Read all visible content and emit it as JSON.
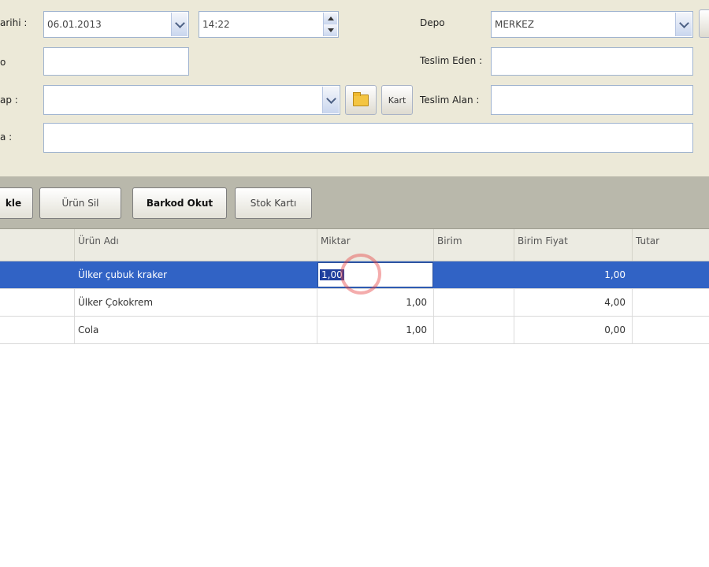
{
  "form": {
    "date_label": "arihi :",
    "date_value": "06.01.2013",
    "time_value": "14:22",
    "depo_label": "Depo",
    "depo_value": "MERKEZ",
    "row2_label": "o",
    "teslim_eden_label": "Teslim Eden :",
    "row3_label": "ap :",
    "kart_button": "Kart",
    "teslim_alan_label": "Teslim Alan :",
    "row4_label": "a :"
  },
  "toolbar": {
    "add_button": "kle",
    "remove_button": "Ürün Sil",
    "barcode_button": "Barkod Okut",
    "stock_button": "Stok Kartı"
  },
  "grid": {
    "columns": [
      "Ürün Adı",
      "Miktar",
      "Birim",
      "Birim Fiyat",
      "Tutar"
    ],
    "rows": [
      {
        "name": "Ülker çubuk kraker",
        "qty": "1,00",
        "unit": "",
        "price": "1,00",
        "total": ""
      },
      {
        "name": "Ülker Çokokrem",
        "qty": "1,00",
        "unit": "",
        "price": "4,00",
        "total": ""
      },
      {
        "name": "Cola",
        "qty": "1,00",
        "unit": "",
        "price": "0,00",
        "total": ""
      }
    ]
  }
}
